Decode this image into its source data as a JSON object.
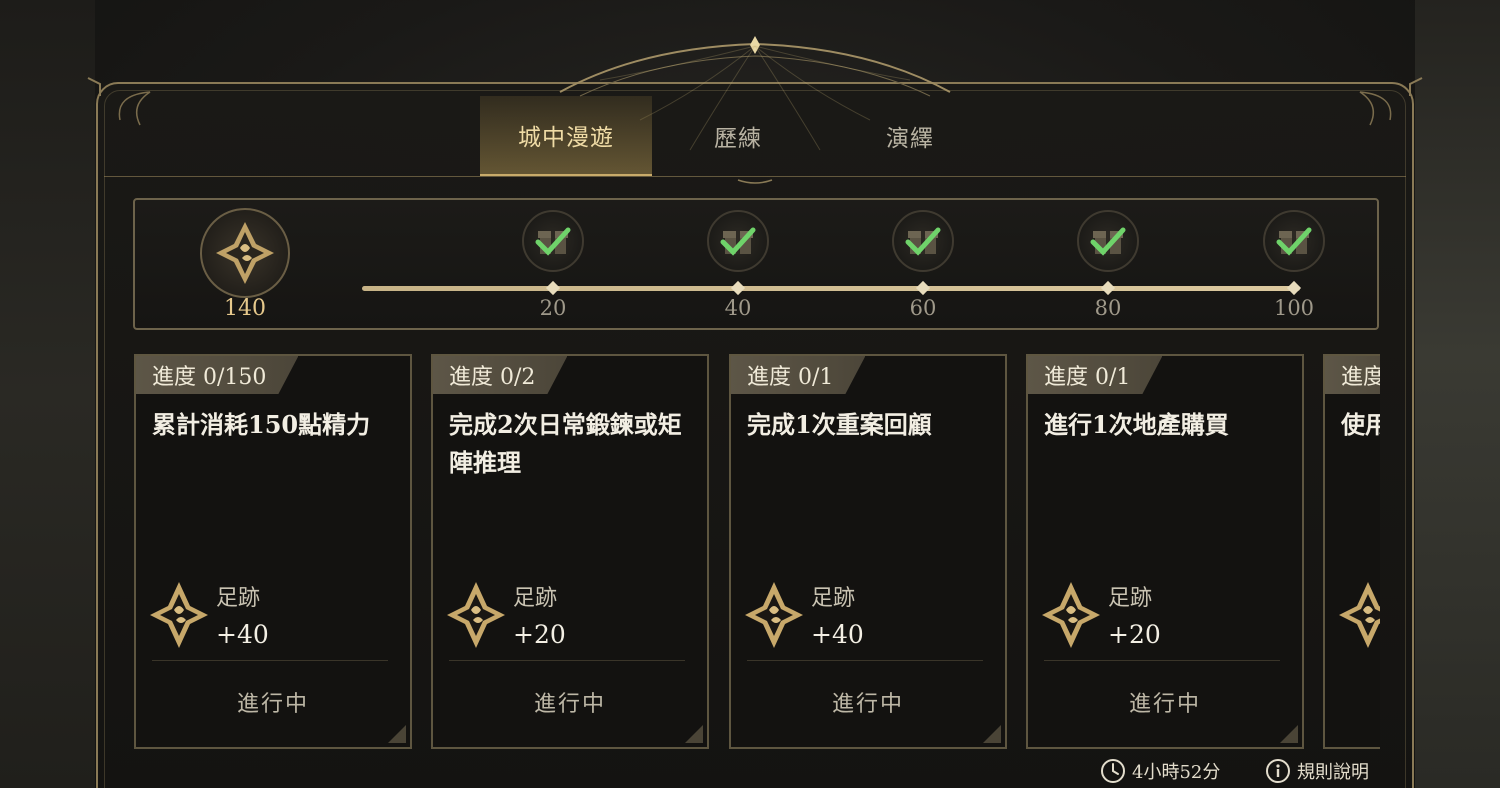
{
  "tabs": [
    {
      "label": "城中漫遊",
      "active": true
    },
    {
      "label": "歷練",
      "active": false
    },
    {
      "label": "演繹",
      "active": false
    }
  ],
  "progress": {
    "current_points": "140",
    "icon": "footprint-emblem-icon",
    "milestones": [
      {
        "value": "20",
        "claimed": true,
        "icon": "gift-claimed-icon"
      },
      {
        "value": "40",
        "claimed": true,
        "icon": "gift-claimed-icon"
      },
      {
        "value": "60",
        "claimed": true,
        "icon": "gift-claimed-icon"
      },
      {
        "value": "80",
        "claimed": true,
        "icon": "gift-claimed-icon"
      },
      {
        "value": "100",
        "claimed": true,
        "icon": "gift-claimed-icon"
      }
    ]
  },
  "tasks": [
    {
      "progress": "進度 0/150",
      "title": "累計消耗150點精力",
      "reward_label": "足跡",
      "reward_value": "+40",
      "status": "進行中"
    },
    {
      "progress": "進度 0/2",
      "title": "完成2次日常鍛鍊或矩陣推理",
      "reward_label": "足跡",
      "reward_value": "+20",
      "status": "進行中"
    },
    {
      "progress": "進度 0/1",
      "title": "完成1次重案回顧",
      "reward_label": "足跡",
      "reward_value": "+40",
      "status": "進行中"
    },
    {
      "progress": "進度 0/1",
      "title": "進行1次地產購買",
      "reward_label": "足跡",
      "reward_value": "+20",
      "status": "進行中"
    },
    {
      "progress": "進度",
      "title": "使用",
      "reward_label": "",
      "reward_value": "",
      "status": ""
    }
  ],
  "footer": {
    "timer": "4小時52分",
    "rules": "規則說明"
  },
  "colors": {
    "accent_gold": "#c9ab6a",
    "check_green": "#6fd36a",
    "frame": "#8a7a56"
  }
}
